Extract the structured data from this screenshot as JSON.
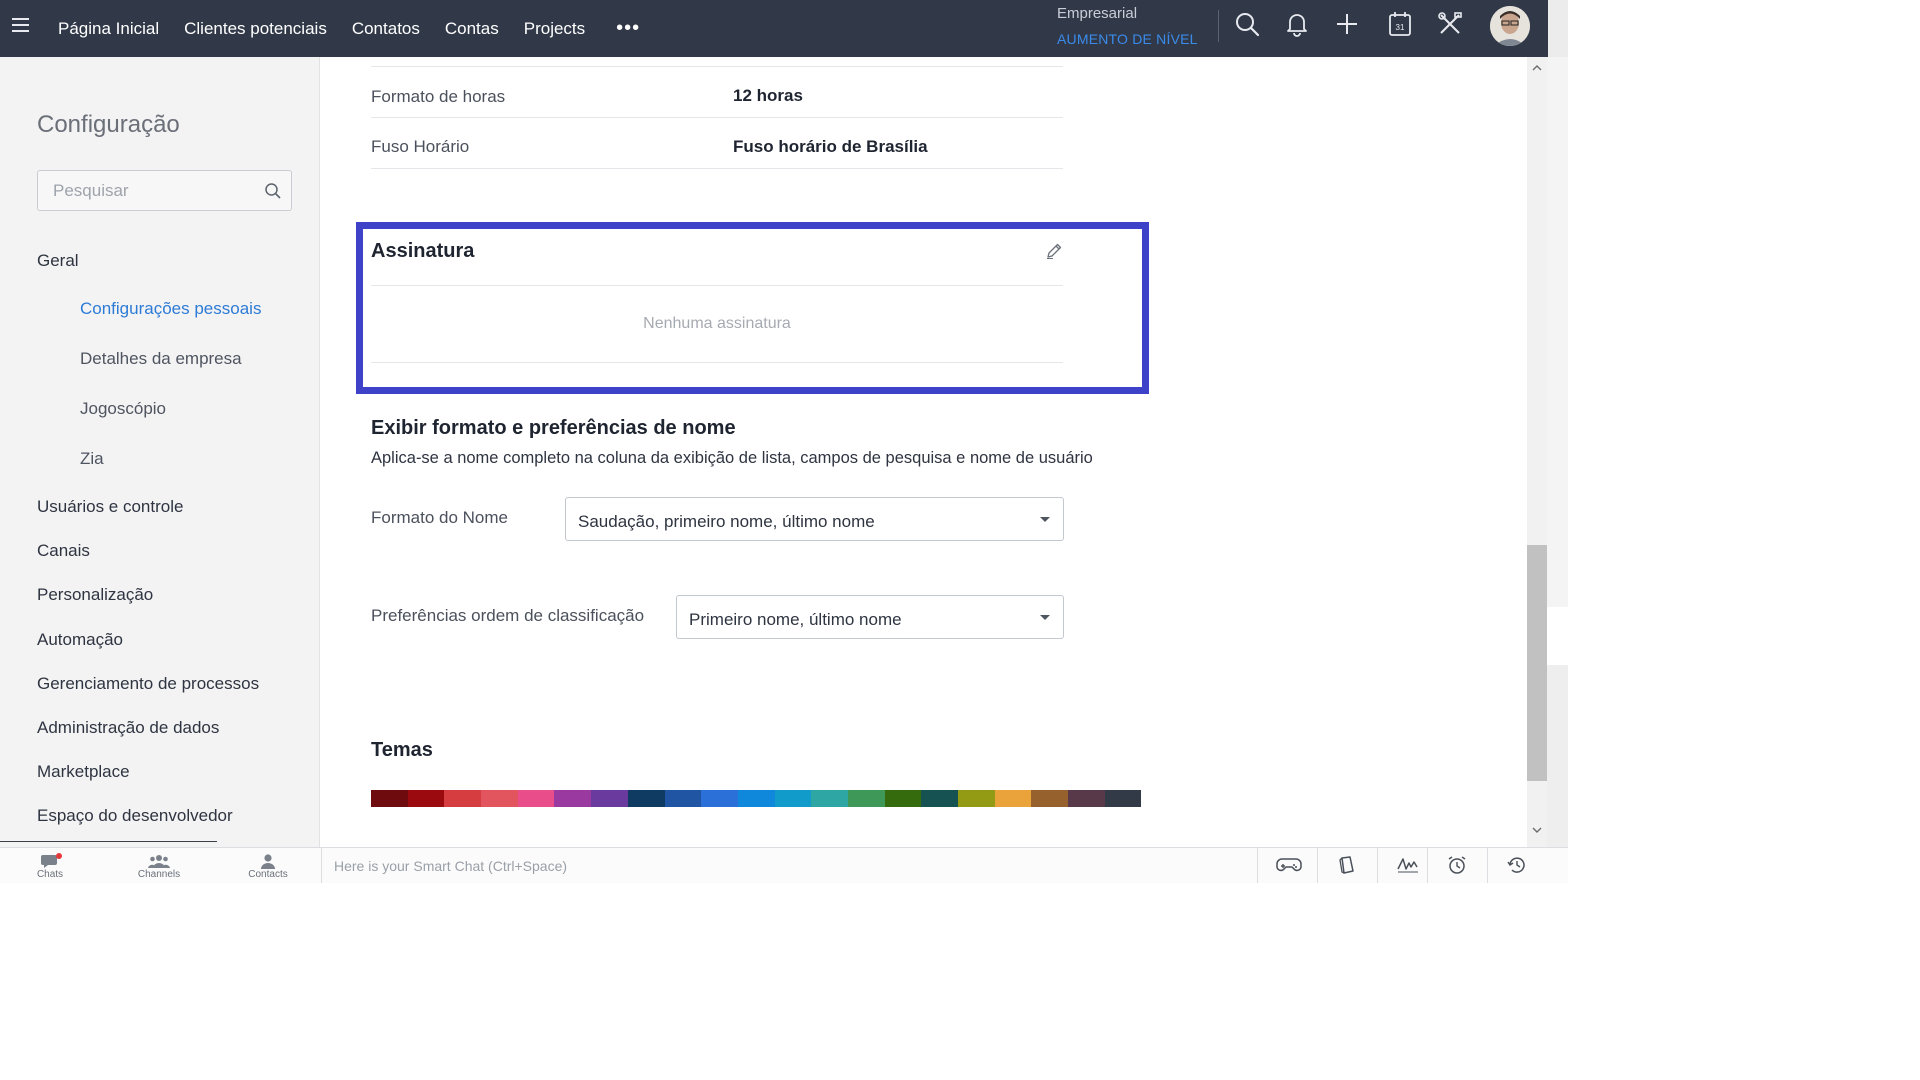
{
  "topbar": {
    "nav": [
      "Página Inicial",
      "Clientes potenciais",
      "Contatos",
      "Contas",
      "Projects"
    ],
    "more": "•••",
    "edition": "Empresarial",
    "upgrade": "AUMENTO DE NÍVEL",
    "calendar_day": "31"
  },
  "sidebar": {
    "title": "Configuração",
    "search_placeholder": "Pesquisar",
    "general": "Geral",
    "sub_items": [
      "Configurações pessoais",
      "Detalhes da empresa",
      "Jogoscópio",
      "Zia"
    ],
    "items": [
      "Usuários e controle",
      "Canais",
      "Personalização",
      "Automação",
      "Gerenciamento de processos",
      "Administração de dados",
      "Marketplace",
      "Espaço do desenvolvedor"
    ]
  },
  "main": {
    "rows": [
      {
        "label": "Formato de horas",
        "value": "12 horas"
      },
      {
        "label": "Fuso Horário",
        "value": "Fuso horário de Brasília"
      }
    ],
    "signature": {
      "title": "Assinatura",
      "empty": "Nenhuma assinatura"
    },
    "name_prefs": {
      "title": "Exibir formato e preferências de nome",
      "desc": "Aplica-se a nome completo na coluna da exibição de lista, campos de pesquisa e nome de usuário",
      "name_format_label": "Formato do Nome",
      "name_format_value": "Saudação, primeiro nome, último nome",
      "sort_label": "Preferências ordem de classificação",
      "sort_value": "Primeiro nome, último nome"
    },
    "themes": {
      "title": "Temas",
      "colors": [
        "#6e0b0e",
        "#9b0a0f",
        "#d63d41",
        "#e2555e",
        "#ea4e8a",
        "#9a3aa0",
        "#6a3a9e",
        "#0f3b62",
        "#1f55a3",
        "#2b6fd8",
        "#0f88dc",
        "#119bcb",
        "#2ea6a3",
        "#3e9858",
        "#356a0d",
        "#175252",
        "#939a13",
        "#eaa33b",
        "#96612d",
        "#57394a",
        "#323a48"
      ]
    }
  },
  "bottombar": {
    "chats": "Chats",
    "channels": "Channels",
    "contacts": "Contacts",
    "smart_chat_placeholder": "Here is your Smart Chat (Ctrl+Space)"
  }
}
